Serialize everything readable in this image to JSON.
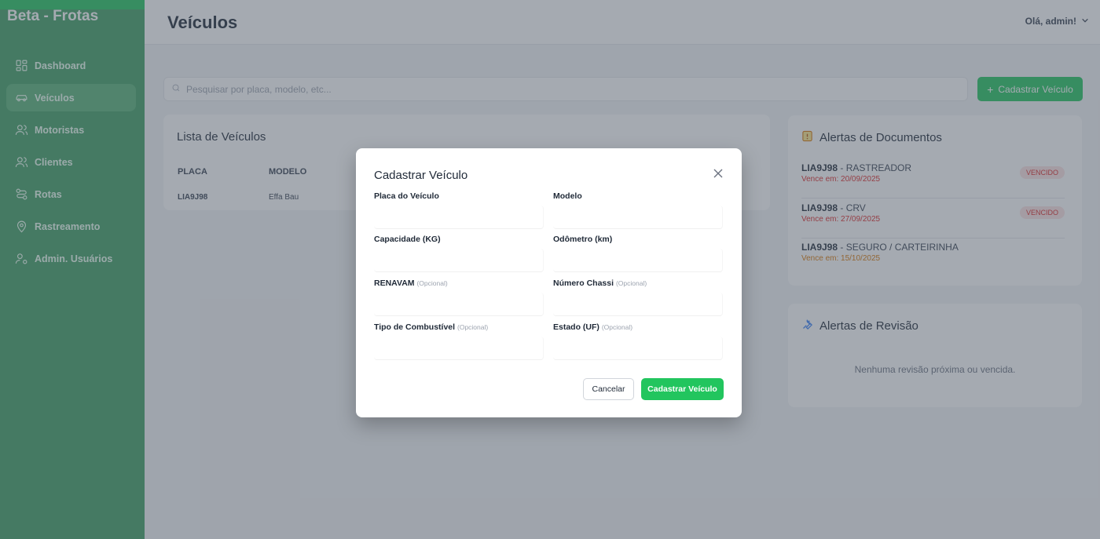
{
  "app": {
    "brand": "Beta - Frotas",
    "accent": "#22c55e",
    "sidebar_bg": "#3f9f63"
  },
  "sidebar": {
    "items": [
      {
        "label": "Dashboard",
        "icon": "dashboard-icon",
        "active": false
      },
      {
        "label": "Veículos",
        "icon": "car-icon",
        "active": true
      },
      {
        "label": "Motoristas",
        "icon": "users-icon",
        "active": false
      },
      {
        "label": "Clientes",
        "icon": "users-icon",
        "active": false
      },
      {
        "label": "Rotas",
        "icon": "route-icon",
        "active": false
      },
      {
        "label": "Rastreamento",
        "icon": "location-pin-icon",
        "active": false
      },
      {
        "label": "Admin. Usuários",
        "icon": "user-admin-icon",
        "active": false
      }
    ]
  },
  "header": {
    "title": "Veículos",
    "user_greeting": "Olá, admin!"
  },
  "search": {
    "placeholder": "Pesquisar por placa, modelo, etc..."
  },
  "toolbar": {
    "add_label": "Cadastrar Veículo",
    "add_icon": "plus-icon"
  },
  "vehicle_list": {
    "title": "Lista de Veículos",
    "columns": [
      "PLACA",
      "MODELO"
    ],
    "rows": [
      {
        "placa": "LIA9J98",
        "modelo": "Effa Bau"
      }
    ]
  },
  "document_alerts": {
    "title": "Alertas de Documentos",
    "icon": "document-alert-icon",
    "items": [
      {
        "plate": "LIA9J98",
        "doc": " - RASTREADOR",
        "due": "Vence em: 20/09/2025",
        "status": "VENCIDO"
      },
      {
        "plate": "LIA9J98",
        "doc": " - CRV",
        "due": "Vence em: 27/09/2025",
        "status": "VENCIDO"
      },
      {
        "plate": "LIA9J98",
        "doc": " - SEGURO / CARTEIRINHA",
        "due": "Vence em: 15/10/2025",
        "status": ""
      }
    ]
  },
  "revision_alerts": {
    "title": "Alertas de Revisão",
    "icon": "wrench-icon",
    "empty": "Nenhuma revisão próxima ou vencida."
  },
  "modal": {
    "title": "Cadastrar Veículo",
    "close_icon": "close-icon",
    "fields": [
      {
        "label": "Placa do Veículo",
        "optional": ""
      },
      {
        "label": "Modelo",
        "optional": ""
      },
      {
        "label": "Capacidade (KG)",
        "optional": ""
      },
      {
        "label": "Odômetro (km)",
        "optional": ""
      },
      {
        "label": "RENAVAM",
        "optional": "(Opcional)"
      },
      {
        "label": "Número Chassi",
        "optional": "(Opcional)"
      },
      {
        "label": "Tipo de Combustível",
        "optional": "(Opcional)"
      },
      {
        "label": "Estado (UF)",
        "optional": "(Opcional)"
      }
    ],
    "cancel_label": "Cancelar",
    "submit_label": "Cadastrar Veículo"
  }
}
